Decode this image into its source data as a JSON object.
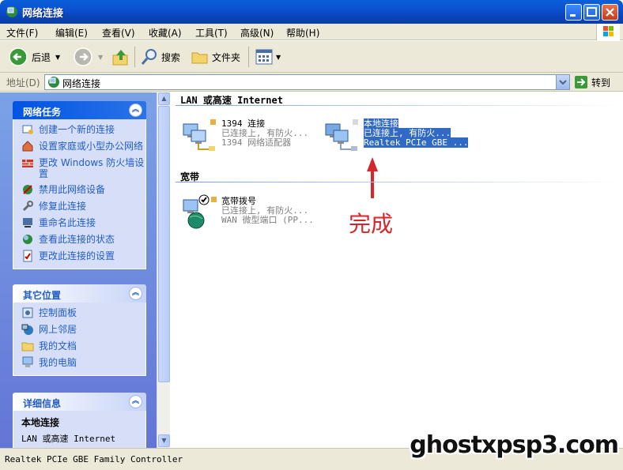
{
  "window": {
    "title": "网络连接"
  },
  "menu": [
    "文件(F)",
    "编辑(E)",
    "查看(V)",
    "收藏(A)",
    "工具(T)",
    "高级(N)",
    "帮助(H)"
  ],
  "toolbar": {
    "back_label": "后退",
    "search_label": "搜索",
    "folders_label": "文件夹"
  },
  "address": {
    "label": "地址(D)",
    "value": "网络连接",
    "go_label": "转到"
  },
  "tasks_panel": {
    "title": "网络任务",
    "items": [
      "创建一个新的连接",
      "设置家庭或小型办公网络",
      "更改 Windows 防火墙设置",
      "禁用此网络设备",
      "修复此连接",
      "重命名此连接",
      "查看此连接的状态",
      "更改此连接的设置"
    ]
  },
  "places_panel": {
    "title": "其它位置",
    "items": [
      "控制面板",
      "网上邻居",
      "我的文档",
      "我的电脑"
    ]
  },
  "details_panel": {
    "title": "详细信息",
    "name": "本地连接",
    "type": "LAN 或高速 Internet"
  },
  "groups": {
    "lan": {
      "title": "LAN 或高速 Internet",
      "connections": [
        {
          "name": "1394 连接",
          "status": "已连接上, 有防火...",
          "device": "1394 网络适配器"
        },
        {
          "name": "本地连接",
          "status": "已连接上, 有防火...",
          "device": "Realtek PCIe GBE ..."
        }
      ]
    },
    "broadband": {
      "title": "宽带",
      "connections": [
        {
          "name": "宽带拨号",
          "status": "已连接上, 有防火...",
          "device": "WAN 微型端口 (PP..."
        }
      ]
    }
  },
  "annotation": "完成",
  "statusbar": {
    "text": "Realtek PCIe GBE Family Controller"
  },
  "watermark": "ghostxpsp3.com",
  "colors": {
    "title_blue": "#0a5fd9",
    "task_link": "#215dc6",
    "selection": "#316ac5",
    "annotation_red": "#d6262b"
  }
}
